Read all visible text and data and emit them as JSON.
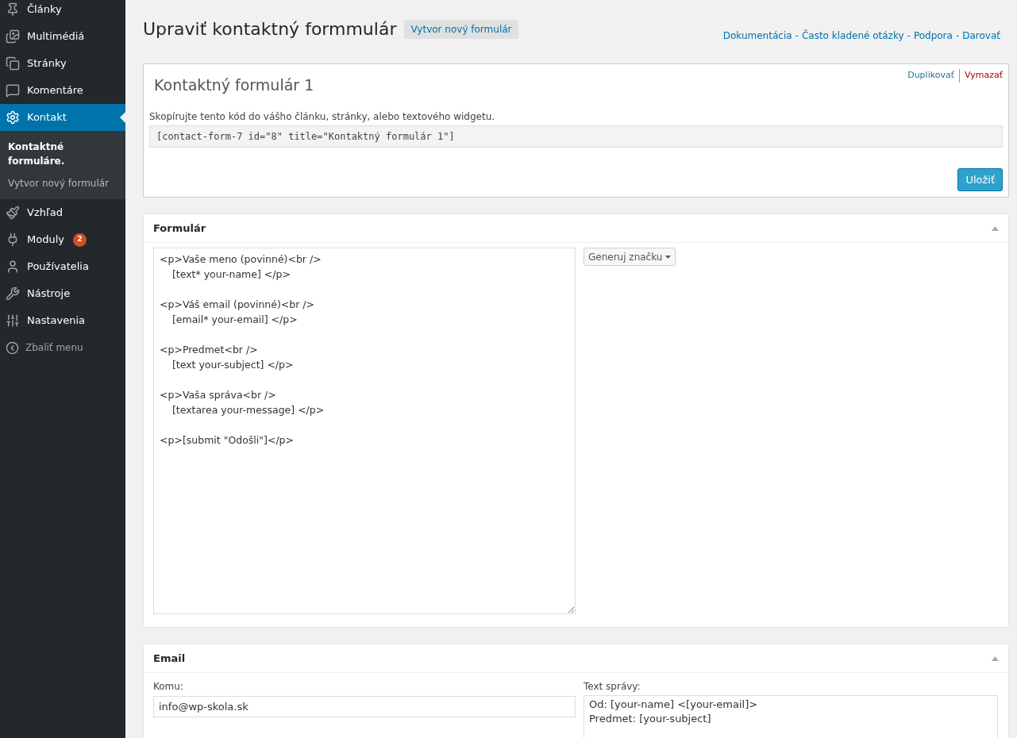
{
  "sidebar": {
    "items": [
      {
        "label": "Články",
        "selected": false
      },
      {
        "label": "Multimédiá",
        "selected": false
      },
      {
        "label": "Stránky",
        "selected": false
      },
      {
        "label": "Komentáre",
        "selected": false
      },
      {
        "label": "Kontakt",
        "selected": true,
        "children": [
          {
            "label": "Kontaktné formuláre.",
            "selected": true
          },
          {
            "label": "Vytvor nový formulár",
            "selected": false
          }
        ]
      },
      {
        "label": "Vzhľad",
        "selected": false
      },
      {
        "label": "Moduly",
        "selected": false,
        "badge": "2"
      },
      {
        "label": "Používatelia",
        "selected": false
      },
      {
        "label": "Nástroje",
        "selected": false
      },
      {
        "label": "Nastavenia",
        "selected": false
      }
    ],
    "collapse": "Zbaliť menu"
  },
  "page": {
    "title": "Upraviť kontaktný formmulár",
    "add_new": "Vytvor nový formulár",
    "help_links": {
      "items": [
        "Dokumentácia",
        "Často kladené otázky",
        "Podpora",
        "Darovať"
      ],
      "separator": "-"
    }
  },
  "form_box": {
    "title": "Kontaktný formulár 1",
    "duplicate": "Duplikovať",
    "delete": "Vymazať",
    "hint": "Skopírujte tento kód do vášho článku, stránky, alebo textového widgetu.",
    "shortcode": "[contact-form-7 id=\"8\" title=\"Kontaktný formulár 1\"]",
    "save": "Uložiť"
  },
  "form_panel": {
    "title": "Formulár",
    "code": "<p>Vaše meno (povinné)<br />\n    [text* your-name] </p>\n\n<p>Váš email (povinné)<br />\n    [email* your-email] </p>\n\n<p>Predmet<br />\n    [text your-subject] </p>\n\n<p>Vaša správa<br />\n    [textarea your-message] </p>\n\n<p>[submit \"Odošli\"]</p>",
    "generate": "Generuj značku"
  },
  "email_panel": {
    "title": "Email",
    "to_label": "Komu:",
    "to_value": "info@wp-skola.sk",
    "body_label": "Text správy:",
    "body_value": "Od: [your-name] <[your-email]>\nPredmet: [your-subject]"
  }
}
